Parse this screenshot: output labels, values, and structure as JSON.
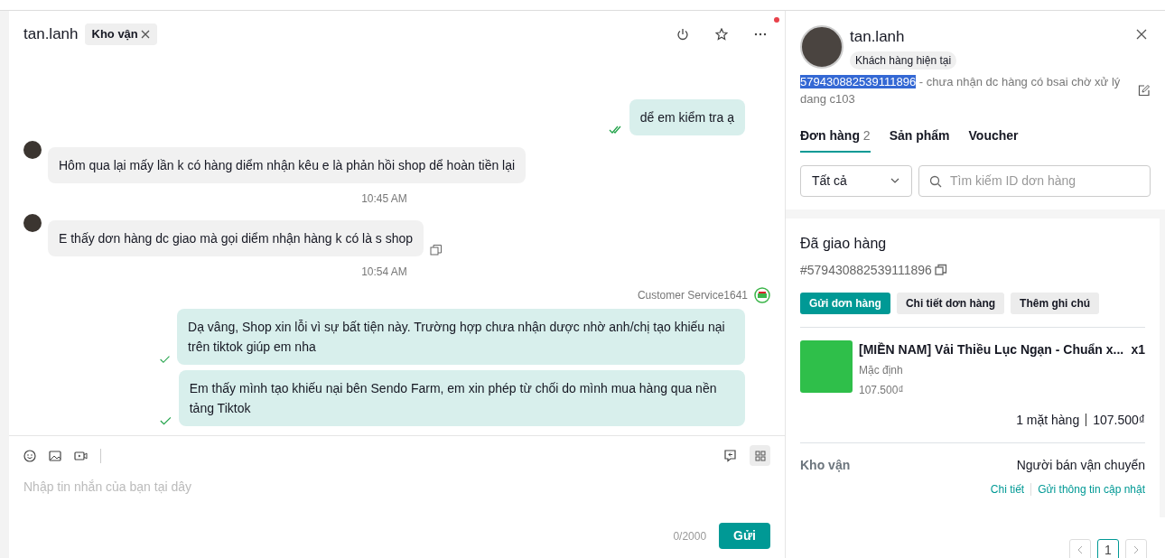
{
  "chat": {
    "title": "tan.lanh",
    "tag": "Kho vận",
    "has_unread": true,
    "messages": [
      {
        "kind": "outgoing",
        "text": "dể em kiểm tra ạ",
        "read": true
      },
      {
        "kind": "incoming",
        "text": "Hôm qua lại mấy lần k có hàng diểm nhận kêu e là phản hồi shop dể hoàn tiền lại",
        "copyable": false
      },
      {
        "kind": "time",
        "text": "10:45 AM"
      },
      {
        "kind": "incoming",
        "text": "E thấy dơn hàng dc giao mà gọi diểm nhận hàng k có là s shop",
        "copyable": true
      },
      {
        "kind": "time",
        "text": "10:54 AM"
      },
      {
        "kind": "sender",
        "text": "Customer Service1641"
      },
      {
        "kind": "outgoing",
        "text": "Dạ vâng, Shop xin lỗi vì sự bất tiện này. Trường hợp chưa nhận dược nhờ anh/chị tạo khiếu nại trên tiktok giúp em nha",
        "read": false
      },
      {
        "kind": "outgoing",
        "text": "Em thấy mình tạo khiếu nại bên Sendo Farm, em xin phép từ chối do mình mua hàng qua nền tảng Tiktok",
        "read": false
      }
    ],
    "composer": {
      "placeholder": "Nhập tin nhắn của bạn tại dây",
      "counter": "0/2000",
      "send": "Gửi"
    }
  },
  "customer": {
    "name": "tan.lanh",
    "badge": "Khách hàng hiện tại",
    "note_id": "579430882539111896",
    "note": " - chưa nhận dc hàng có bsai chờ xử lý dang c103",
    "tabs": [
      {
        "label": "Đơn hàng",
        "count": "2",
        "selected": true
      },
      {
        "label": "Sản phẩm",
        "selected": false
      },
      {
        "label": "Voucher",
        "selected": false
      }
    ],
    "filter": "Tất cả",
    "search": {
      "placeholder": "Tìm kiếm ID dơn hàng"
    }
  },
  "order": {
    "status": "Đã giao hàng",
    "id": "#579430882539111896",
    "actions": [
      {
        "label": "Gửi dơn hàng",
        "primary": true
      },
      {
        "label": "Chi tiết dơn hàng",
        "primary": false
      },
      {
        "label": "Thêm ghi chú",
        "primary": false
      }
    ],
    "product": {
      "name": "[MIỀN NAM] Vải Thiều Lục Ngạn - Chuẩn x...",
      "qty": "x1",
      "variant": "Mặc định",
      "price": "107.500₫"
    },
    "summary_count": "1 mặt hàng",
    "summary_total": "107.500₫",
    "logistics_label": "Kho vận",
    "logistics_value": "Người bán vận chuyển",
    "links": [
      "Chi tiết",
      "Gửi thông tin cập nhật"
    ]
  },
  "pagination": {
    "pages": [
      {
        "label": "1",
        "selected": true
      }
    ]
  }
}
